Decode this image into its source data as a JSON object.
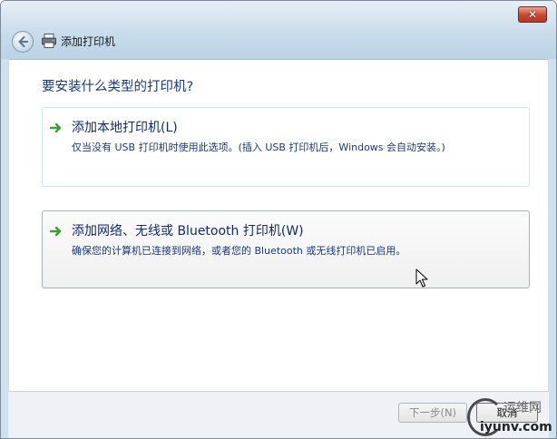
{
  "window": {
    "title": "添加打印机",
    "close_label": "✕"
  },
  "main": {
    "heading": "要安装什么类型的打印机?",
    "options": [
      {
        "title": "添加本地打印机(L)",
        "description": "仅当没有 USB 打印机时使用此选项。(插入 USB 打印机后，Windows 会自动安装。)"
      },
      {
        "title": "添加网络、无线或 Bluetooth 打印机(W)",
        "description": "确保您的计算机已连接到网络，或者您的 Bluetooth 或无线打印机已启用。"
      }
    ]
  },
  "footer": {
    "next_label": "下一步(N)",
    "cancel_label": "取消"
  },
  "watermark": {
    "top": "运维网",
    "bottom": "iyunv.com"
  },
  "colors": {
    "accent": "#1a3a7a",
    "arrow": "#3aa12a"
  }
}
